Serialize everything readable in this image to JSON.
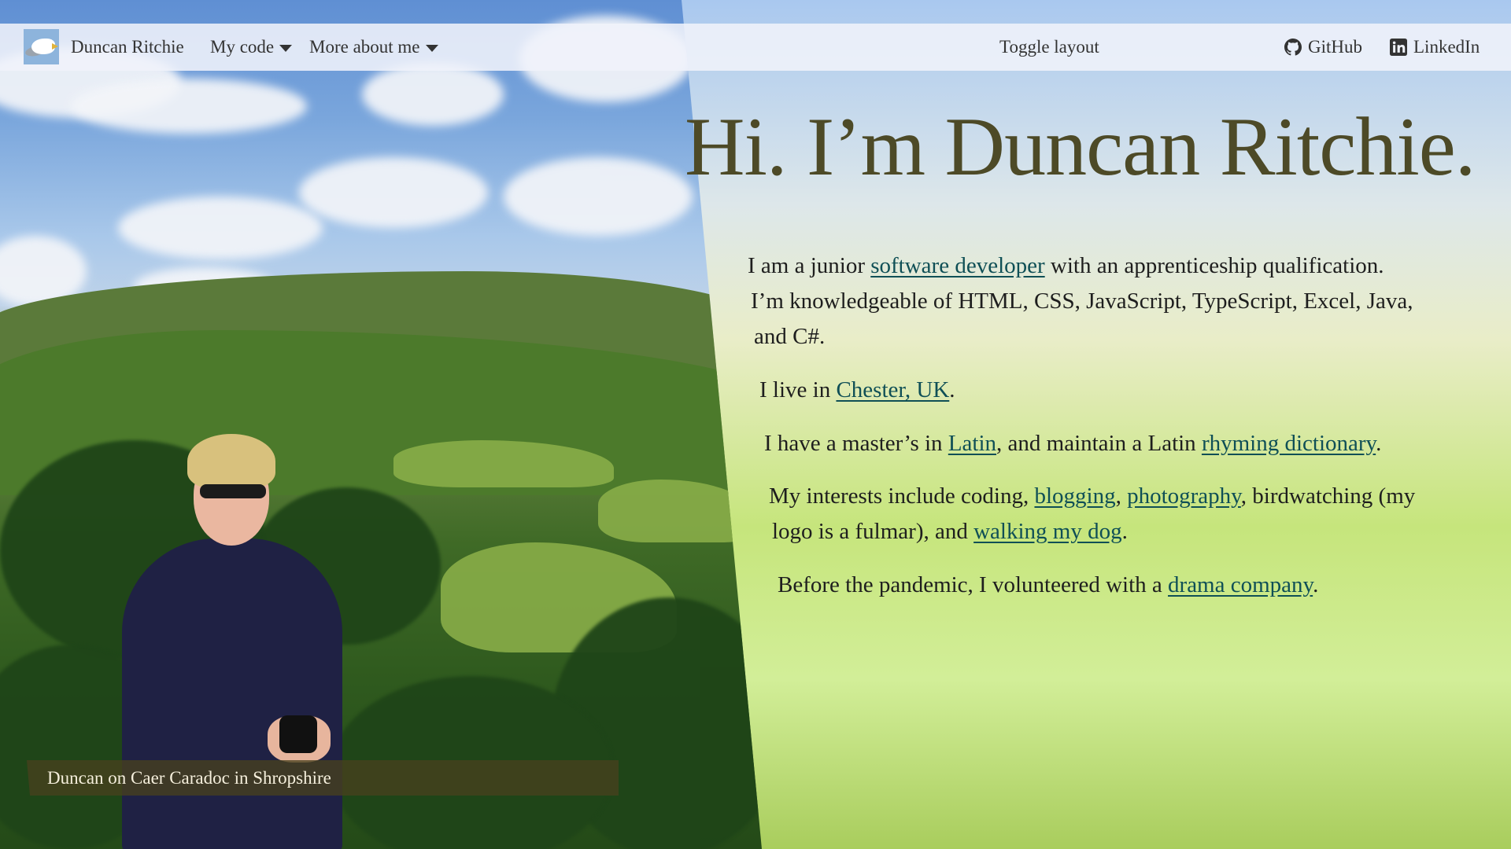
{
  "navbar": {
    "brand_name": "Duncan Ritchie",
    "logo_icon": "fulmar-logo",
    "menus": [
      {
        "label": "My code",
        "icon": "chevron-down-icon"
      },
      {
        "label": "More about me",
        "icon": "chevron-down-icon"
      }
    ],
    "toggle_label": "Toggle layout",
    "github_label": "GitHub",
    "linkedin_label": "LinkedIn"
  },
  "hero": {
    "headline": "Hi. I’m Duncan Ritchie.",
    "photo_caption": "Duncan on Caer Caradoc in Shropshire"
  },
  "about": {
    "p1": {
      "t1": "I am a junior ",
      "link1": "software developer",
      "t2": " with an apprenticeship qualification.",
      "line2": "I’m knowledgeable of HTML, CSS, JavaScript, TypeScript, Excel, Java,",
      "line3": "and C#."
    },
    "p2": {
      "t1": "I live in ",
      "link1": "Chester, UK",
      "t2": "."
    },
    "p3": {
      "t1": "I have a master’s in ",
      "link1": "Latin",
      "t2": ", and maintain a Latin ",
      "link2": "rhyming dictionary",
      "t3": "."
    },
    "p4": {
      "t1": "My interests include coding, ",
      "link1": "blogging",
      "t2": ", ",
      "link2": "photography",
      "t3": ", birdwatching (my",
      "line2a": "logo is a fulmar), and ",
      "link3": "walking my dog",
      "t4": "."
    },
    "p5": {
      "t1": "Before the pandemic, I volunteered with a ",
      "link1": "drama company",
      "t2": "."
    }
  },
  "colors": {
    "headline": "#4d4a27",
    "link": "#0f4f56",
    "text": "#1e1e1e",
    "navbar_bg": "#f0f3fa",
    "caption_bg": "#48401e"
  }
}
